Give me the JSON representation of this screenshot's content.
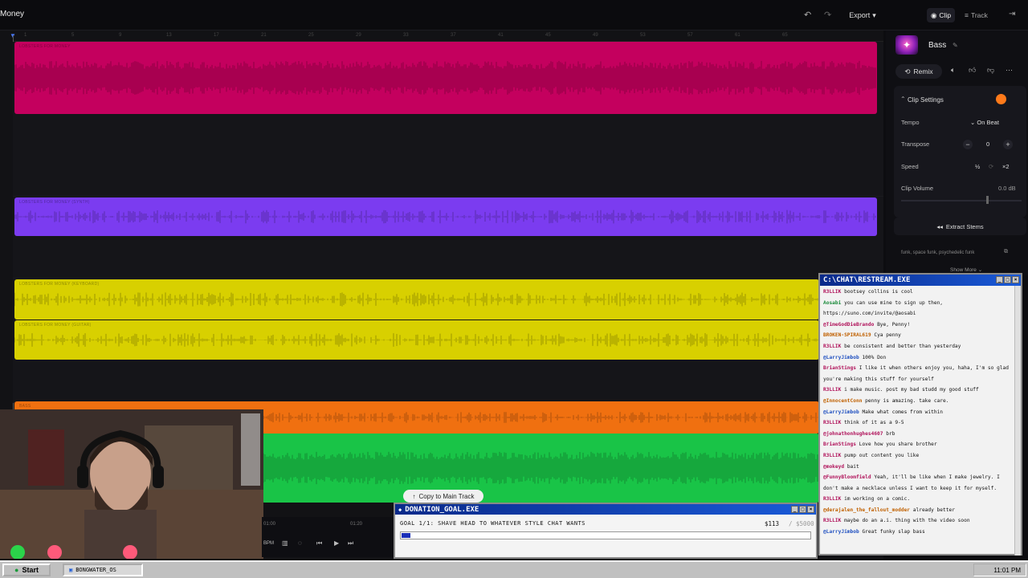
{
  "header": {
    "app_title": "Money",
    "export_label": "Export",
    "tabs": [
      {
        "label": "Clip"
      },
      {
        "label": "Track"
      }
    ]
  },
  "ruler": {
    "ticks": [
      "1",
      "5",
      "9",
      "13",
      "17",
      "21",
      "25",
      "29",
      "33",
      "37",
      "41",
      "45",
      "49",
      "53",
      "57",
      "61",
      "65"
    ]
  },
  "tracks": [
    {
      "label": "LOBSTERS FOR MONEY",
      "color": "#c4005e"
    },
    {
      "label": "LOBSTERS FOR MONEY (SYNTH)",
      "color": "#7b3cf0"
    },
    {
      "label": "LOBSTERS FOR MONEY (KEYBOARD)",
      "color": "#d8d000"
    },
    {
      "label": "LOBSTERS FOR MONEY (GUITAR)",
      "color": "#d8d000"
    },
    {
      "label": "BASS",
      "color": "#f07010"
    },
    {
      "label": "",
      "color": "#19c447"
    }
  ],
  "right_panel": {
    "song_name": "Bass",
    "remix_label": "Remix",
    "clip_settings_title": "Clip Settings",
    "accent_color": "#ff7a1a",
    "tempo_label": "Tempo",
    "tempo_value": "On Beat",
    "transpose_label": "Transpose",
    "transpose_value": "0",
    "speed_label": "Speed",
    "speed_half": "½",
    "speed_double": "×2",
    "clip_volume_label": "Clip Volume",
    "clip_volume_value": "0.0 dB",
    "extract_stems_label": "Extract Stems",
    "tags": "funk, space funk, psychedelic funk",
    "show_more_label": "Show More"
  },
  "chat": {
    "title": "C:\\CHAT\\RESTREAM.EXE",
    "messages": [
      {
        "user": "R3LLIK",
        "text": "bootsey collins is cool",
        "cls": ""
      },
      {
        "user": "Aosabi",
        "text": "you can use mine to sign up then,",
        "cls": "g"
      },
      {
        "user": "",
        "text": "https://suno.com/invite/@aosabi",
        "cls": ""
      },
      {
        "user": "@TimeGodDieBrando",
        "text": "Bye, Penny!",
        "cls": ""
      },
      {
        "user": "BROKEN-SPIRAL619",
        "text": "Cya penny",
        "cls": "o"
      },
      {
        "user": "R3LLIK",
        "text": "be consistent and better than yesterday",
        "cls": ""
      },
      {
        "user": "@LarryJimbob",
        "text": "100% Don",
        "cls": "b"
      },
      {
        "user": "BrianStings",
        "text": "I like it when others enjoy you, haha, I'm so glad",
        "cls": ""
      },
      {
        "user": "",
        "text": "you're making this stuff for yourself",
        "cls": ""
      },
      {
        "user": "R3LLIK",
        "text": "i make music. post my bad studd my good stuff",
        "cls": ""
      },
      {
        "user": "@InnocentConn",
        "text": "penny is amazing. take care.",
        "cls": "o"
      },
      {
        "user": "@LarryJimbob",
        "text": "Make what comes from within",
        "cls": "b"
      },
      {
        "user": "R3LLIK",
        "text": "think of it as a 9-5",
        "cls": ""
      },
      {
        "user": "@johnathonhughes4607",
        "text": "brb",
        "cls": ""
      },
      {
        "user": "BrianStings",
        "text": "Love how you share brother",
        "cls": ""
      },
      {
        "user": "R3LLIK",
        "text": "pump out content you like",
        "cls": ""
      },
      {
        "user": "@mokeyd",
        "text": "bait",
        "cls": ""
      },
      {
        "user": "@FunnyBloomfield",
        "text": "Yeah, it'll be like when I make jewelry. I",
        "cls": ""
      },
      {
        "user": "",
        "text": "don't make a necklace unless I want to keep it for myself.",
        "cls": ""
      },
      {
        "user": "R3LLIK",
        "text": "im working on a comic.",
        "cls": ""
      },
      {
        "user": "@derajalen_the_fallout_modder",
        "text": "already better",
        "cls": "o"
      },
      {
        "user": "R3LLIK",
        "text": "maybe do an a.i. thing with the video soon",
        "cls": ""
      },
      {
        "user": "@LarryJimbob",
        "text": "Great funky slap bass",
        "cls": "b"
      }
    ]
  },
  "copy_to_main_label": "Copy to Main Track",
  "donation": {
    "title": "DONATION_GOAL.EXE",
    "goal_text": "GOAL 1/1: SHAVE HEAD TO WHATEVER STYLE CHAT WANTS",
    "amount": "$113",
    "total": "/ $5000",
    "progress": 0.0226
  },
  "transport": {
    "time_start": "01:00",
    "time_mid": "01:20",
    "bpm_label": "BPM"
  },
  "taskbar": {
    "start_label": "Start",
    "task_label": "BONGWATER_OS",
    "clock": "11:01 PM"
  }
}
